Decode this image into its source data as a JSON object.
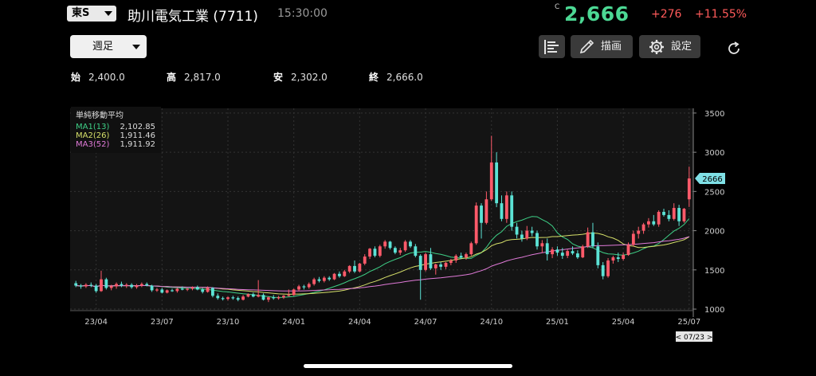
{
  "header": {
    "market": "東S",
    "stock_name": "助川電気工業 (7711)",
    "time": "15:30:00",
    "price_tag": "C",
    "price": "2,666",
    "change": "+276",
    "change_pct": "+11.55%"
  },
  "toolbar": {
    "period": "週足",
    "draw_label": "描画",
    "settings_label": "設定"
  },
  "ohlc": {
    "open_label": "始",
    "open": "2,400.0",
    "high_label": "高",
    "high": "2,817.0",
    "low_label": "安",
    "low": "2,302.0",
    "close_label": "終",
    "close": "2,666.0"
  },
  "legend": {
    "title": "単純移動平均",
    "items": [
      {
        "name": "MA1(13)",
        "value": "2,102.85",
        "color": "#3ecf86"
      },
      {
        "name": "MA2(26)",
        "value": "1,911.46",
        "color": "#d6e06a"
      },
      {
        "name": "MA3(52)",
        "value": "1,911.92",
        "color": "#e07ad8"
      }
    ]
  },
  "colors": {
    "up": "#ff5a6a",
    "down": "#5ce3d6",
    "price_up_text": "#4cd894",
    "change_text": "#ff5a5a"
  },
  "chart_data": {
    "type": "candlestick",
    "y_ticks": [
      1000,
      1500,
      2000,
      2500,
      3000,
      3500
    ],
    "ylim": [
      980,
      3560
    ],
    "x_ticks": [
      {
        "label": "23/04",
        "i": 4
      },
      {
        "label": "23/07",
        "i": 17
      },
      {
        "label": "23/10",
        "i": 30
      },
      {
        "label": "24/01",
        "i": 43
      },
      {
        "label": "24/04",
        "i": 56
      },
      {
        "label": "24/07",
        "i": 69
      },
      {
        "label": "24/10",
        "i": 82
      },
      {
        "label": "25/01",
        "i": 95
      },
      {
        "label": "25/04",
        "i": 108
      },
      {
        "label": "25/07",
        "i": 121
      }
    ],
    "last_price_label": "2666",
    "cursor_label": "< 07/23 >",
    "candles": [
      [
        1330,
        1360,
        1280,
        1300
      ],
      [
        1300,
        1320,
        1260,
        1290
      ],
      [
        1290,
        1330,
        1270,
        1310
      ],
      [
        1310,
        1340,
        1280,
        1300
      ],
      [
        1300,
        1320,
        1210,
        1230
      ],
      [
        1230,
        1490,
        1220,
        1380
      ],
      [
        1380,
        1400,
        1250,
        1270
      ],
      [
        1270,
        1310,
        1240,
        1290
      ],
      [
        1290,
        1340,
        1260,
        1320
      ],
      [
        1320,
        1350,
        1280,
        1300
      ],
      [
        1300,
        1330,
        1270,
        1310
      ],
      [
        1310,
        1330,
        1260,
        1280
      ],
      [
        1280,
        1320,
        1260,
        1300
      ],
      [
        1300,
        1340,
        1280,
        1320
      ],
      [
        1320,
        1340,
        1290,
        1300
      ],
      [
        1300,
        1310,
        1220,
        1240
      ],
      [
        1240,
        1270,
        1220,
        1250
      ],
      [
        1250,
        1270,
        1200,
        1210
      ],
      [
        1210,
        1250,
        1200,
        1240
      ],
      [
        1240,
        1260,
        1220,
        1230
      ],
      [
        1230,
        1270,
        1210,
        1260
      ],
      [
        1260,
        1290,
        1240,
        1250
      ],
      [
        1250,
        1270,
        1230,
        1260
      ],
      [
        1260,
        1290,
        1240,
        1280
      ],
      [
        1280,
        1300,
        1240,
        1250
      ],
      [
        1250,
        1270,
        1200,
        1220
      ],
      [
        1220,
        1290,
        1210,
        1270
      ],
      [
        1270,
        1280,
        1150,
        1170
      ],
      [
        1170,
        1200,
        1120,
        1140
      ],
      [
        1140,
        1160,
        1110,
        1130
      ],
      [
        1130,
        1160,
        1110,
        1150
      ],
      [
        1150,
        1170,
        1120,
        1140
      ],
      [
        1140,
        1160,
        1100,
        1120
      ],
      [
        1120,
        1180,
        1110,
        1160
      ],
      [
        1160,
        1200,
        1150,
        1190
      ],
      [
        1190,
        1210,
        1150,
        1160
      ],
      [
        1160,
        1370,
        1150,
        1180
      ],
      [
        1180,
        1200,
        1110,
        1120
      ],
      [
        1120,
        1160,
        1090,
        1150
      ],
      [
        1150,
        1180,
        1120,
        1140
      ],
      [
        1140,
        1170,
        1120,
        1150
      ],
      [
        1150,
        1180,
        1130,
        1170
      ],
      [
        1170,
        1250,
        1160,
        1180
      ],
      [
        1180,
        1260,
        1170,
        1250
      ],
      [
        1250,
        1310,
        1230,
        1290
      ],
      [
        1290,
        1310,
        1250,
        1280
      ],
      [
        1280,
        1340,
        1260,
        1320
      ],
      [
        1320,
        1400,
        1300,
        1380
      ],
      [
        1380,
        1410,
        1340,
        1360
      ],
      [
        1360,
        1420,
        1340,
        1400
      ],
      [
        1400,
        1420,
        1360,
        1380
      ],
      [
        1380,
        1460,
        1370,
        1450
      ],
      [
        1450,
        1480,
        1400,
        1420
      ],
      [
        1420,
        1500,
        1410,
        1480
      ],
      [
        1480,
        1560,
        1460,
        1550
      ],
      [
        1550,
        1620,
        1460,
        1480
      ],
      [
        1480,
        1590,
        1470,
        1580
      ],
      [
        1580,
        1700,
        1560,
        1670
      ],
      [
        1670,
        1780,
        1640,
        1770
      ],
      [
        1770,
        1800,
        1660,
        1680
      ],
      [
        1680,
        1820,
        1660,
        1800
      ],
      [
        1800,
        1880,
        1770,
        1860
      ],
      [
        1860,
        1870,
        1760,
        1780
      ],
      [
        1780,
        1800,
        1700,
        1720
      ],
      [
        1720,
        1780,
        1690,
        1750
      ],
      [
        1750,
        1880,
        1730,
        1860
      ],
      [
        1860,
        1880,
        1780,
        1800
      ],
      [
        1800,
        1830,
        1660,
        1680
      ],
      [
        1680,
        1700,
        1120,
        1500
      ],
      [
        1500,
        1720,
        1480,
        1700
      ],
      [
        1700,
        1780,
        1500,
        1520
      ],
      [
        1520,
        1580,
        1440,
        1570
      ],
      [
        1570,
        1600,
        1500,
        1540
      ],
      [
        1540,
        1600,
        1510,
        1590
      ],
      [
        1590,
        1640,
        1560,
        1620
      ],
      [
        1620,
        1700,
        1590,
        1680
      ],
      [
        1680,
        1720,
        1640,
        1660
      ],
      [
        1660,
        1720,
        1630,
        1700
      ],
      [
        1700,
        1860,
        1680,
        1840
      ],
      [
        1840,
        2360,
        1820,
        2320
      ],
      [
        2320,
        2350,
        1900,
        2100
      ],
      [
        2100,
        2500,
        2080,
        2400
      ],
      [
        2400,
        3210,
        2380,
        2870
      ],
      [
        2870,
        3000,
        2300,
        2350
      ],
      [
        2350,
        2450,
        2120,
        2150
      ],
      [
        2150,
        2500,
        2100,
        2450
      ],
      [
        2450,
        2500,
        2000,
        2050
      ],
      [
        2050,
        2100,
        1900,
        1950
      ],
      [
        1950,
        2000,
        1860,
        1900
      ],
      [
        1900,
        2060,
        1880,
        2000
      ],
      [
        2000,
        2050,
        1930,
        1970
      ],
      [
        1970,
        2000,
        1760,
        1800
      ],
      [
        1800,
        1880,
        1720,
        1840
      ],
      [
        1840,
        1900,
        1620,
        1700
      ],
      [
        1700,
        1790,
        1650,
        1760
      ],
      [
        1760,
        1800,
        1680,
        1720
      ],
      [
        1720,
        1780,
        1640,
        1680
      ],
      [
        1680,
        1760,
        1650,
        1740
      ],
      [
        1740,
        1800,
        1690,
        1710
      ],
      [
        1710,
        1750,
        1640,
        1660
      ],
      [
        1660,
        1820,
        1650,
        1800
      ],
      [
        1800,
        2040,
        1780,
        1980
      ],
      [
        1980,
        2100,
        1780,
        1800
      ],
      [
        1800,
        1850,
        1520,
        1560
      ],
      [
        1560,
        1600,
        1380,
        1420
      ],
      [
        1420,
        1650,
        1400,
        1620
      ],
      [
        1620,
        1680,
        1580,
        1660
      ],
      [
        1660,
        1720,
        1600,
        1640
      ],
      [
        1640,
        1720,
        1620,
        1690
      ],
      [
        1690,
        1850,
        1680,
        1820
      ],
      [
        1820,
        2000,
        1800,
        1960
      ],
      [
        1960,
        2050,
        1900,
        2000
      ],
      [
        2000,
        2100,
        1960,
        2080
      ],
      [
        2080,
        2160,
        2040,
        2120
      ],
      [
        2120,
        2200,
        2060,
        2080
      ],
      [
        2080,
        2260,
        2050,
        2240
      ],
      [
        2240,
        2280,
        2180,
        2200
      ],
      [
        2200,
        2260,
        2120,
        2150
      ],
      [
        2150,
        2350,
        2130,
        2290
      ],
      [
        2290,
        2330,
        2060,
        2120
      ],
      [
        2120,
        2290,
        2100,
        2280
      ],
      [
        2400,
        2817,
        2302,
        2666
      ]
    ]
  }
}
